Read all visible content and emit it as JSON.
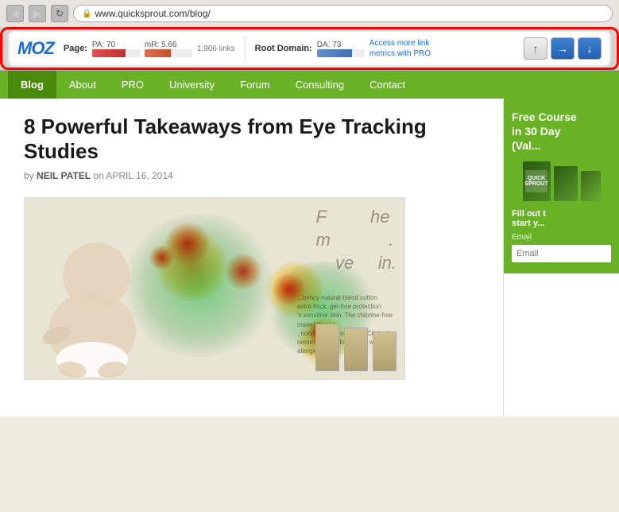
{
  "browser": {
    "url": "www.quicksprout.com/blog/",
    "nav_back": "◀",
    "nav_forward": "▶",
    "nav_refresh": "↻"
  },
  "mozbar": {
    "logo": "MOZ",
    "page_label": "Page:",
    "pa_label": "PA:",
    "pa_value": "70",
    "mr_label": "mR:",
    "mr_value": "5.66",
    "links_value": "1,906 links",
    "root_label": "Root Domain:",
    "da_label": "DA:",
    "da_value": "73",
    "access_text": "Access more link",
    "access_text2": "metrics with PRO",
    "btn_up": "↑",
    "btn_right": "→",
    "btn_down": "↓"
  },
  "nav": {
    "items": [
      "Blog",
      "About",
      "PRO",
      "University",
      "Forum",
      "Consulting",
      "Contact"
    ],
    "active": "Blog"
  },
  "article": {
    "title": "8 Powerful Takeaways from Eye Tracking Studies",
    "byline_prefix": "by",
    "author": "NEIL PATEL",
    "byline_mid": "on",
    "date": "APRIL 16, 2014",
    "heatmap_overlay_text": "F...he\nm....\nve...in.",
    "heatmap_small_text": "...bency natural-blend cotton extra thick, gel-free protection 's sensitive skin. The chlorine-free materials and , non-toxic non-irritating. Clinically -non-toxic non-irritating, Clinically recommended for babies with allergies"
  },
  "sidebar": {
    "widget_title": "Free Course\nin 30 Day\n(Val...",
    "form_label": "Fill out t\nstart y...",
    "email_placeholder": "Email",
    "book_label": "QUICKSPROUT"
  }
}
